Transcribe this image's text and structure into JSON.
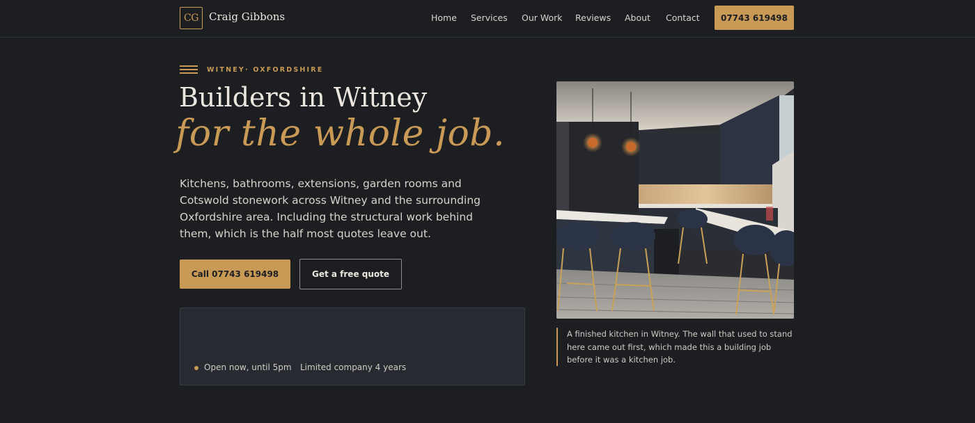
{
  "brand": {
    "monogram": "CG",
    "name": "Craig Gibbons"
  },
  "nav": {
    "items": [
      "Home",
      "Services",
      "Our Work",
      "Reviews",
      "About",
      "Contact"
    ],
    "phone_label": "07743 619498"
  },
  "hero": {
    "eyebrow": "WITNEY· OXFORDSHIRE",
    "title_line1": "Builders in Witney",
    "title_line2": "for the whole job.",
    "lead": "Kitchens, bathrooms, extensions, garden rooms and Cotswold stonework across Witney and the surrounding Oxfordshire area. Including the structural work behind them, which is the half most quotes leave out.",
    "cta_primary": "Call 07743 619498",
    "cta_secondary": "Get a free quote",
    "status": "Open now, until 5pm",
    "company": "Limited company 4 years",
    "caption": "A finished kitchen in Witney. The wall that used to stand here came out first, which made this a building job before it was a kitchen job."
  },
  "colors": {
    "accent": "#c99a56",
    "background": "#1c1e22",
    "panel": "#272a31"
  }
}
